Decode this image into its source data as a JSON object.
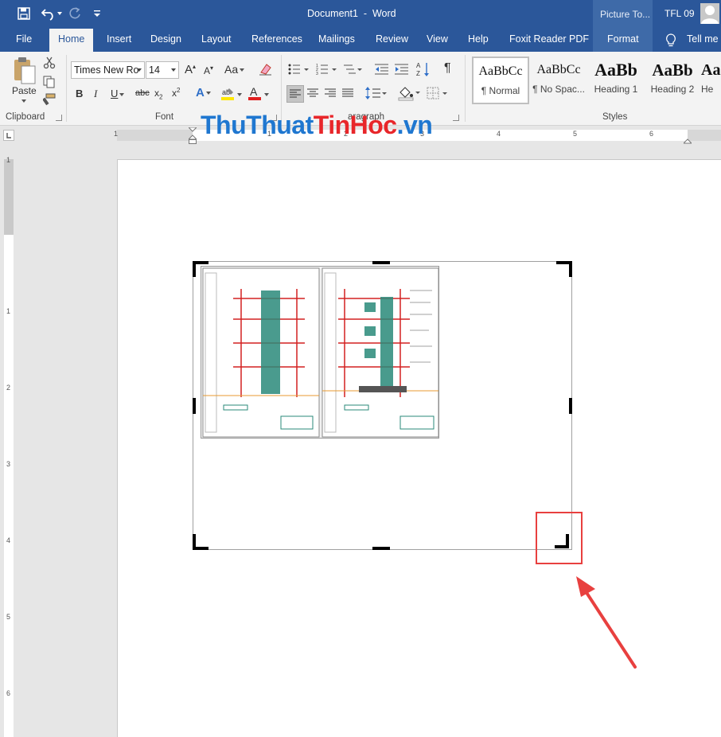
{
  "titlebar": {
    "document_title": "Document1  -  Word",
    "context_tab": "Picture To...",
    "user": "TFL 09"
  },
  "tabs": [
    "File",
    "Home",
    "Insert",
    "Design",
    "Layout",
    "References",
    "Mailings",
    "Review",
    "View",
    "Help",
    "Foxit Reader PDF",
    "Format"
  ],
  "active_tab": "Home",
  "tell_me": "Tell me",
  "clipboard": {
    "paste_label": "Paste",
    "group_label": "Clipboard"
  },
  "font": {
    "family": "Times New Ro",
    "size": "14",
    "group_label": "Font"
  },
  "paragraph": {
    "group_label": "aragraph"
  },
  "styles": {
    "group_label": "Styles",
    "items": [
      {
        "preview": "AaBbCc",
        "name": "¶ Normal"
      },
      {
        "preview": "AaBbCc",
        "name": "¶ No Spac..."
      },
      {
        "preview": "AaBb",
        "name": "Heading 1"
      },
      {
        "preview": "AaBb",
        "name": "Heading 2"
      },
      {
        "preview": "Aa",
        "name": "He"
      }
    ]
  },
  "watermark": {
    "part1": "ThuThuat",
    "part2": "TinHoc",
    "part3": ".vn"
  },
  "ruler": {
    "h_numbers": [
      "1",
      "1",
      "2",
      "3",
      "4",
      "5",
      "6"
    ],
    "v_numbers": [
      "1",
      "1",
      "2",
      "3",
      "4",
      "5",
      "6"
    ]
  },
  "colors": {
    "accent": "#2b579a",
    "annotation": "#e8403f"
  },
  "icons": [
    "save-icon",
    "undo-icon",
    "redo-icon",
    "customize-qat-icon",
    "cut-icon",
    "copy-icon",
    "format-painter-icon",
    "bold-icon",
    "italic-icon",
    "underline-icon",
    "strikethrough-icon",
    "subscript-icon",
    "superscript-icon",
    "text-effects-icon",
    "highlight-icon",
    "font-color-icon",
    "bullets-icon",
    "numbering-icon",
    "multilevel-icon",
    "decrease-indent-icon",
    "increase-indent-icon",
    "sort-icon",
    "pilcrow-icon",
    "align-left-icon",
    "center-icon",
    "align-right-icon",
    "justify-icon",
    "line-spacing-icon",
    "shading-icon",
    "borders-icon",
    "lightbulb-icon",
    "avatar-icon",
    "arrow-icon"
  ]
}
